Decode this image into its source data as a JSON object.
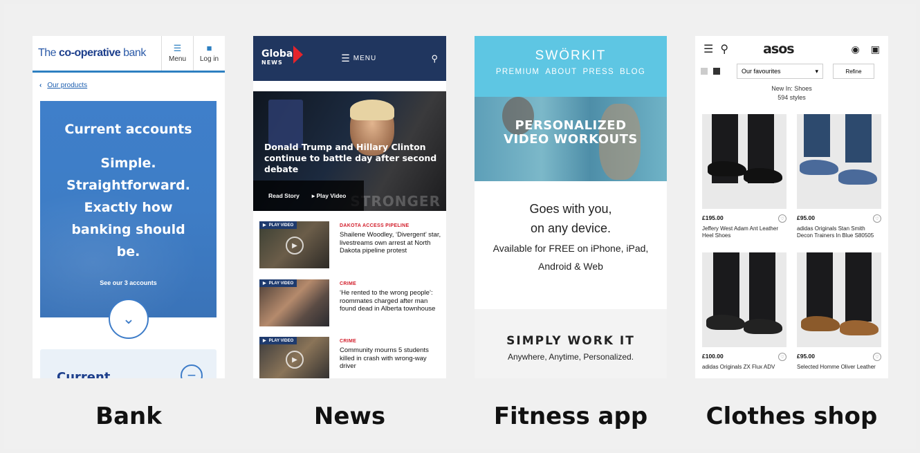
{
  "bank": {
    "logo_prefix": "The",
    "logo_bold": "co-operative",
    "logo_suffix": "bank",
    "menu_label": "Menu",
    "login_label": "Log in",
    "breadcrumb": "Our products",
    "hero_title": "Current accounts",
    "tagline": [
      "Simple.",
      "Straightforward.",
      "Exactly how",
      "banking should",
      "be."
    ],
    "see_link": "See our 3 accounts",
    "card_title": "Current"
  },
  "news": {
    "logo": "Global",
    "logo_sub": "NEWS",
    "menu_label": "MENU",
    "hero_headline": "Donald Trump and Hillary Clinton continue to battle day after second debate",
    "read_story": "Read Story",
    "play_video": "▸ Play Video",
    "watermark": "STRONGER",
    "items": [
      {
        "badge": "PLAY VIDEO",
        "category": "DAKOTA ACCESS PIPELINE",
        "title": "Shailene Woodley, ‘Divergent’ star, livestreams own arrest at North Dakota pipeline protest"
      },
      {
        "badge": "PLAY VIDEO",
        "category": "CRIME",
        "title": "‘He rented to the wrong people’: roommates charged after man found dead in Alberta townhouse"
      },
      {
        "badge": "PLAY VIDEO",
        "category": "CRIME",
        "title": "Community mourns 5 students killed in crash with wrong-way driver"
      }
    ]
  },
  "fitness": {
    "brand": "SWÖRKIT",
    "nav": [
      "PREMIUM",
      "ABOUT",
      "PRESS",
      "BLOG"
    ],
    "hero_line1": "PERSONALIZED",
    "hero_line2": "VIDEO WORKOUTS",
    "mid_line1": "Goes with you,",
    "mid_line2": "on any device.",
    "mid_line3": "Available for FREE on iPhone, iPad, Android & Web",
    "bot_heading": "SIMPLY WORK IT",
    "bot_sub": "Anywhere, Anytime, Personalized."
  },
  "asos": {
    "logo": "asos",
    "sort_label": "Our favourites",
    "refine_label": "Refine",
    "category": "New In: Shoes",
    "count": "594 styles",
    "products": [
      {
        "price": "£195.00",
        "name": "Jeffery West Adam Ant Leather Heel Shoes"
      },
      {
        "price": "£95.00",
        "name": "adidas Originals Stan Smith Decon Trainers In Blue S80505"
      },
      {
        "price": "£100.00",
        "name": "adidas Originals ZX Flux ADV"
      },
      {
        "price": "£95.00",
        "name": "Selected Homme Oliver Leather"
      }
    ]
  },
  "captions": [
    "Bank",
    "News",
    "Fitness app",
    "Clothes shop"
  ]
}
